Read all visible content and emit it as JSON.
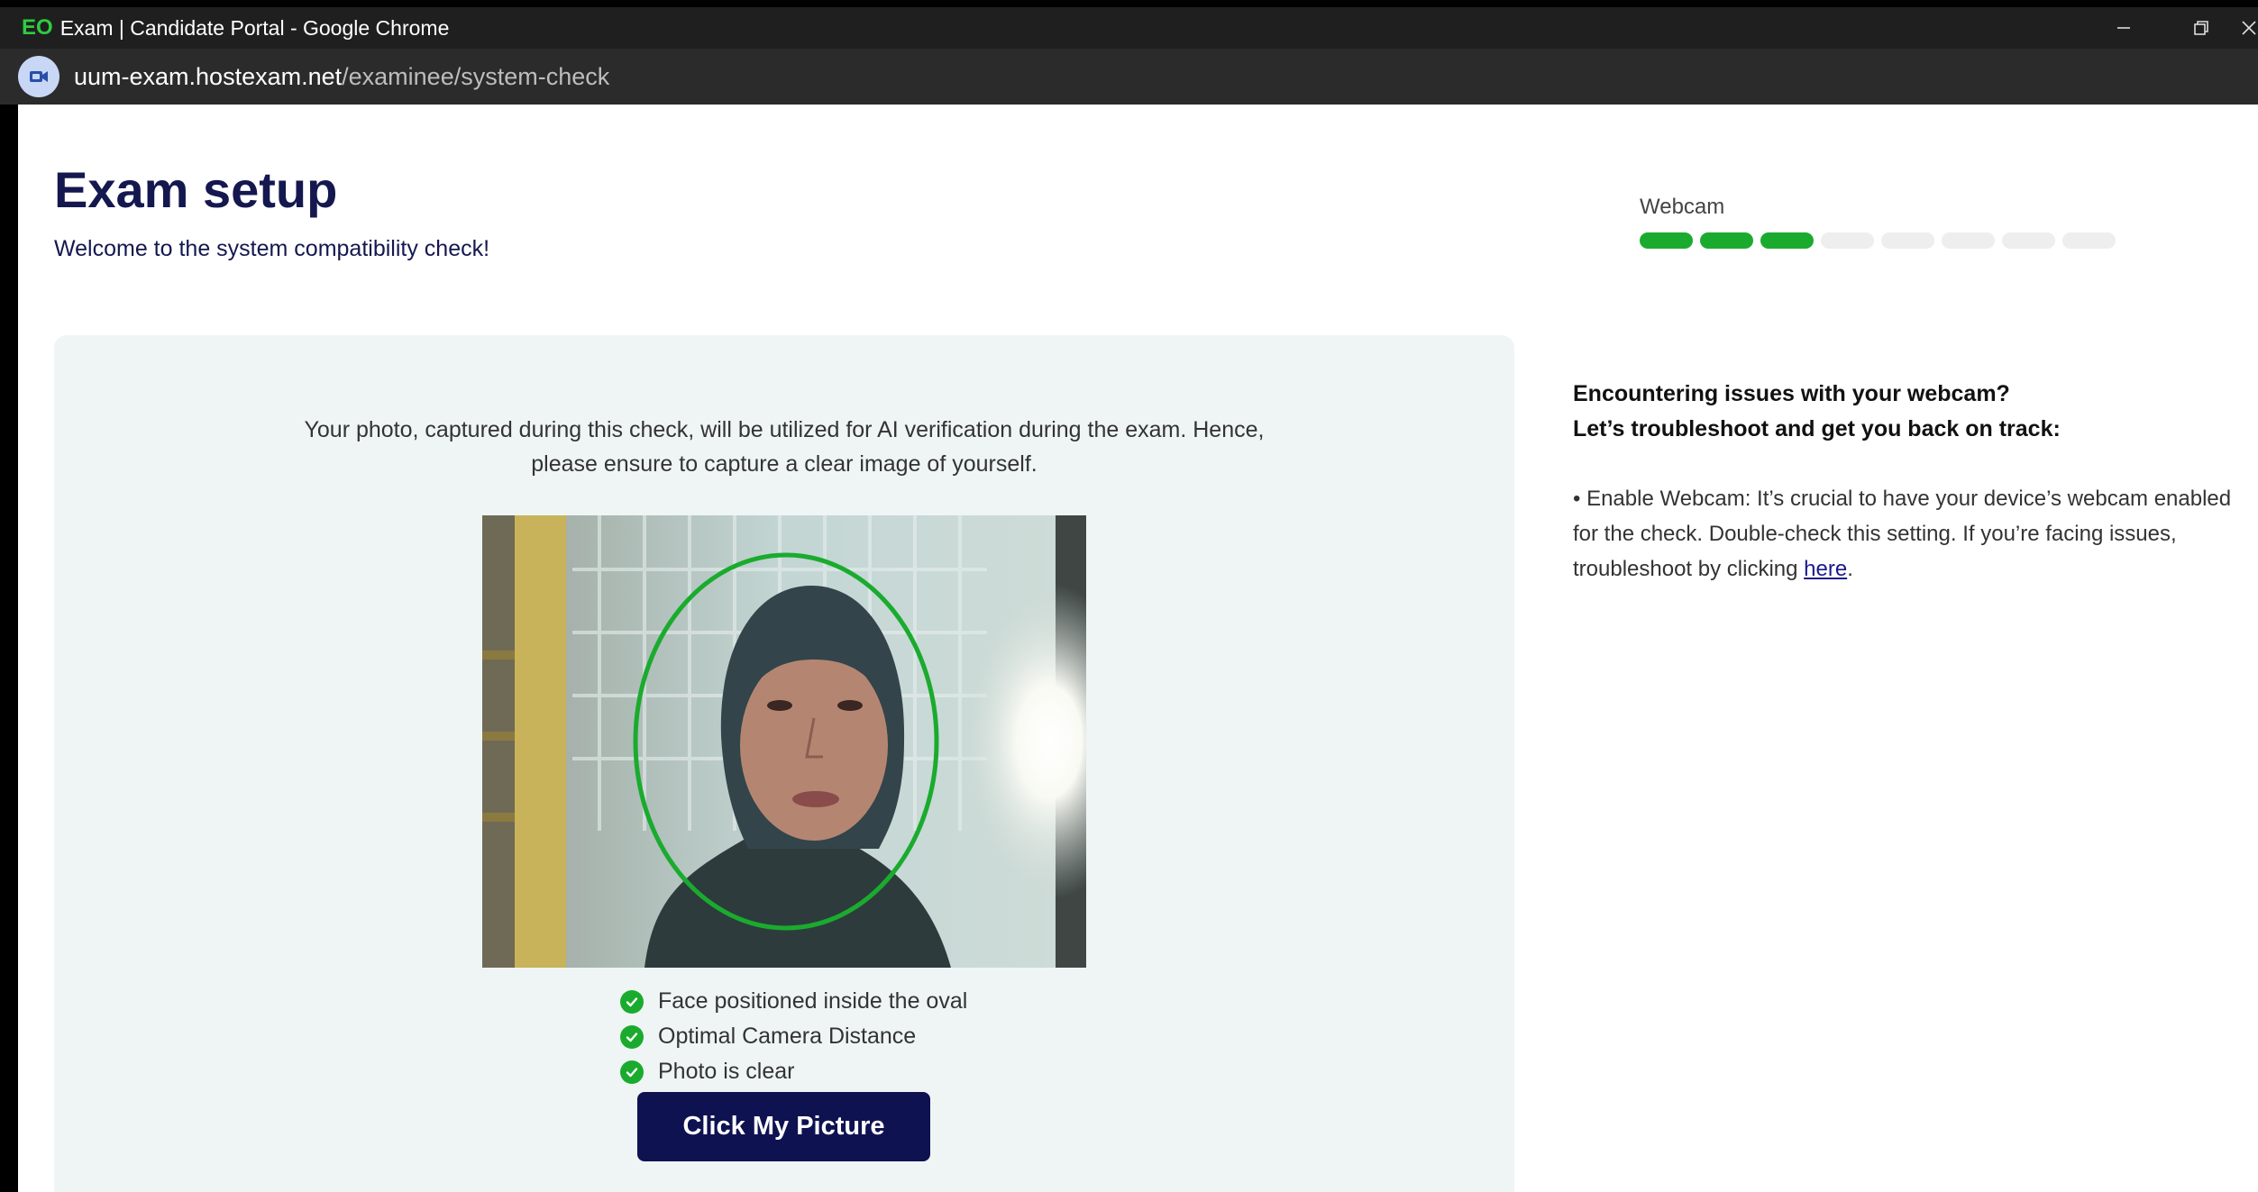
{
  "browser": {
    "app_logo": "EO",
    "window_title": "Exam | Candidate Portal - Google Chrome",
    "url_host": "uum-exam.hostexam.net",
    "url_path": "/examinee/system-check"
  },
  "header": {
    "title": "Exam setup",
    "subtitle": "Welcome to the system compatibility check!"
  },
  "progress": {
    "label": "Webcam",
    "completed_steps": 3,
    "total_steps": 8
  },
  "webcam": {
    "intro_line1": "Your photo, captured during this check, will be utilized for AI verification during the exam. Hence,",
    "intro_line2": "please ensure to capture a clear image of yourself.",
    "checks": [
      "Face positioned inside the oval",
      "Optimal Camera Distance",
      "Photo is clear"
    ],
    "capture_label": "Click My Picture"
  },
  "help": {
    "title_line1": "Encountering issues with your webcam?",
    "title_line2": "Let’s troubleshoot and get you back on track:",
    "bullet_text": "•  Enable Webcam: It’s crucial to have your device’s webcam enabled for the check. Double-check this setting. If you’re facing issues, troubleshoot by clicking ",
    "link_text": "here",
    "after_link": "."
  },
  "colors": {
    "brand_navy": "#14184f",
    "button_navy": "#0e1250",
    "success_green": "#1aab2e",
    "card_bg": "#eff5f5"
  }
}
